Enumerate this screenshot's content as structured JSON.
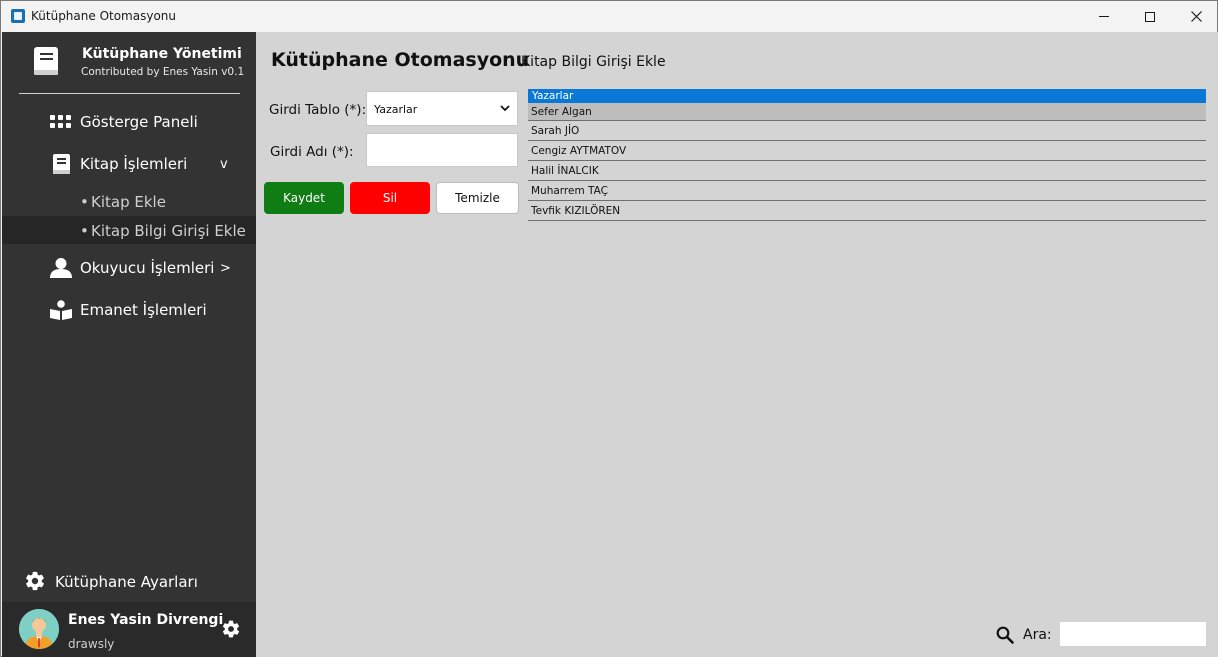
{
  "window": {
    "title": "Kütüphane Otomasyonu",
    "controls": {
      "minimize": "minimize-icon",
      "maximize": "maximize-icon",
      "close": "close-icon"
    }
  },
  "sidebar": {
    "brand_title": "Kütüphane Yönetimi",
    "brand_subtitle": "Contributed by Enes Yasin v0.1",
    "nav": [
      {
        "label": "Gösterge Paneli",
        "icon": "dashboard-grid-icon",
        "arrow": ""
      },
      {
        "label": "Kitap İşlemleri",
        "icon": "book-icon",
        "arrow": "v"
      },
      {
        "label": "Okuyucu İşlemleri",
        "icon": "user-icon",
        "arrow": ">"
      },
      {
        "label": "Emanet İşlemleri",
        "icon": "reader-book-icon",
        "arrow": ""
      }
    ],
    "sub_items": [
      {
        "bullet": "•",
        "label": "Kitap Ekle"
      },
      {
        "bullet": "•",
        "label": "Kitap Bilgi Girişi Ekle"
      }
    ],
    "settings_label": "Kütüphane Ayarları",
    "user": {
      "name": "Enes Yasin Divrengi",
      "handle": "drawsly"
    }
  },
  "main": {
    "title": "Kütüphane Otomasyonu",
    "subtitle": "Kitap Bilgi Girişi Ekle",
    "form": {
      "table_label": "Girdi Tablo (*):",
      "table_value": "Yazarlar",
      "name_label": "Girdi Adı (*):",
      "name_value": ""
    },
    "buttons": {
      "save": "Kaydet",
      "delete": "Sil",
      "clear": "Temizle"
    },
    "list": {
      "header": "Yazarlar",
      "rows": [
        "Sefer Algan",
        "Sarah JİO",
        "Cengiz AYTMATOV",
        "Halil İNALCIK",
        "Muharrem TAÇ",
        "Tevfik KIZILÖREN"
      ]
    },
    "search": {
      "label": "Ara:",
      "value": ""
    }
  },
  "colors": {
    "sidebar": "#333333",
    "main_bg": "#d4d4d4",
    "save": "#0f7d13",
    "delete": "#ff0000",
    "selection": "#0a78d6"
  }
}
